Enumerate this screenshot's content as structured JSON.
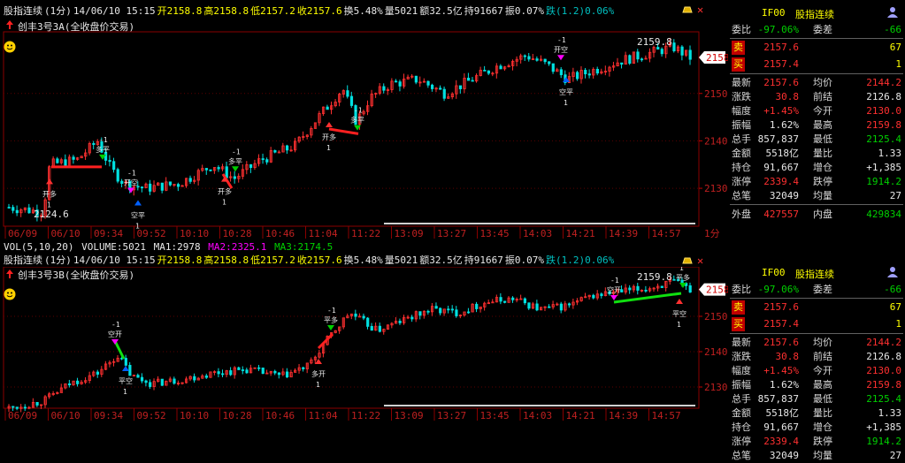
{
  "top_pane": {
    "header": [
      {
        "text": "股指连续",
        "color": "white"
      },
      {
        "text": "(1分)",
        "color": "white"
      },
      {
        "text": "14/06/10 15:15",
        "color": "white"
      },
      {
        "text": "开2158.8",
        "color": "yellow"
      },
      {
        "text": "高2158.8",
        "color": "yellow"
      },
      {
        "text": "低2157.2",
        "color": "yellow"
      },
      {
        "text": "收2157.6",
        "color": "yellow"
      },
      {
        "text": "换5.48%",
        "color": "white"
      },
      {
        "text": "量5021",
        "color": "white"
      },
      {
        "text": "额32.5亿",
        "color": "white"
      },
      {
        "text": "持91667",
        "color": "white"
      },
      {
        "text": "振0.07%",
        "color": "white"
      },
      {
        "text": "跌(1.2)0.06%",
        "color": "cyan"
      }
    ],
    "strategy": "创丰3号3A(全收盘价交易)",
    "y_ticks": [
      "2150",
      "2140",
      "2130"
    ],
    "price_tag": "2158",
    "high_label": "2159.8",
    "low_label": "2124.6",
    "x_ticks": [
      "06/09",
      "06/10",
      "09:34",
      "09:52",
      "10:10",
      "10:28",
      "10:46",
      "11:04",
      "11:22",
      "13:09",
      "13:27",
      "13:45",
      "14:03",
      "14:21",
      "14:39",
      "14:57"
    ],
    "period": "1分",
    "signals": [
      {
        "label": "开多",
        "qty": "1",
        "arrow": "up",
        "color": "#ff3030"
      },
      {
        "label": "多平",
        "qty": "-1",
        "arrow": "down",
        "color": "#00d000"
      },
      {
        "label": "开空",
        "qty": "-1",
        "arrow": "down",
        "color": "#ff00ff"
      },
      {
        "label": "空平",
        "qty": "1",
        "arrow": "up",
        "color": "#0060ff"
      },
      {
        "label": "开多",
        "qty": "1",
        "arrow": "up",
        "color": "#ff3030"
      },
      {
        "label": "多平",
        "qty": "-1",
        "arrow": "down",
        "color": "#00d000"
      },
      {
        "label": "开多",
        "qty": "1",
        "arrow": "up",
        "color": "#ff3030"
      },
      {
        "label": "多平",
        "qty": "-1",
        "arrow": "down",
        "color": "#00d000"
      },
      {
        "label": "开空",
        "qty": "-1",
        "arrow": "down",
        "color": "#ff00ff"
      },
      {
        "label": "空平",
        "qty": "1",
        "arrow": "up",
        "color": "#0060ff"
      }
    ]
  },
  "volume_header": {
    "label": "VOL(5,10,20)",
    "volume": "VOLUME:5021",
    "ma1": "MA1:2978",
    "ma2": "MA2:2325.1",
    "ma3": "MA3:2174.5"
  },
  "bottom_pane": {
    "header": [
      {
        "text": "股指连续",
        "color": "white"
      },
      {
        "text": "(1分)",
        "color": "white"
      },
      {
        "text": "14/06/10 15:15",
        "color": "white"
      },
      {
        "text": "开2158.8",
        "color": "yellow"
      },
      {
        "text": "高2158.8",
        "color": "yellow"
      },
      {
        "text": "低2157.2",
        "color": "yellow"
      },
      {
        "text": "收2157.6",
        "color": "yellow"
      },
      {
        "text": "换5.48%",
        "color": "white"
      },
      {
        "text": "量5021",
        "color": "white"
      },
      {
        "text": "额32.5亿",
        "color": "white"
      },
      {
        "text": "持91667",
        "color": "white"
      },
      {
        "text": "振0.07%",
        "color": "white"
      },
      {
        "text": "跌(1.2)0.06%",
        "color": "cyan"
      }
    ],
    "strategy": "创丰3号3B(全收盘价交易)",
    "y_ticks": [
      "2150",
      "2140",
      "2130"
    ],
    "price_tag": "2158",
    "high_label": "2159.8",
    "x_ticks": [
      "06/09",
      "06/10",
      "09:34",
      "09:52",
      "10:10",
      "10:28",
      "10:46",
      "11:04",
      "11:22",
      "13:09",
      "13:27",
      "13:45",
      "14:03",
      "14:21",
      "14:39",
      "14:57"
    ],
    "signals": [
      {
        "label": "空开",
        "qty": "-1",
        "arrow": "down",
        "color": "#ff00ff"
      },
      {
        "label": "平空",
        "qty": "1",
        "arrow": "up",
        "color": "#0060ff"
      },
      {
        "label": "多开",
        "qty": "1",
        "arrow": "up",
        "color": "#ff3030"
      },
      {
        "label": "平多",
        "qty": "-1",
        "arrow": "down",
        "color": "#00d000"
      },
      {
        "label": "空开",
        "qty": "-1",
        "arrow": "down",
        "color": "#ff00ff"
      },
      {
        "label": "平多",
        "qty": "1",
        "arrow": "down",
        "color": "#00d000"
      },
      {
        "label": "平空",
        "qty": "1",
        "arrow": "up",
        "color": "#ff3030"
      }
    ]
  },
  "quote_panel": {
    "symbol": "IF00",
    "name": "股指连续",
    "rows_top": [
      {
        "l": "委比",
        "v1": "-97.06%",
        "v1c": "green",
        "l2": "委差",
        "v2": "-66",
        "v2c": "green"
      }
    ],
    "ask": {
      "l": "卖",
      "price": "2157.6",
      "qty": "67"
    },
    "bid": {
      "l": "买",
      "price": "2157.4",
      "qty": "1"
    },
    "rows": [
      {
        "l": "最新",
        "v1": "2157.6",
        "v1c": "red",
        "l2": "均价",
        "v2": "2144.2",
        "v2c": "red"
      },
      {
        "l": "涨跌",
        "v1": "30.8",
        "v1c": "red",
        "l2": "前结",
        "v2": "2126.8",
        "v2c": "white"
      },
      {
        "l": "幅度",
        "v1": "+1.45%",
        "v1c": "red",
        "l2": "今开",
        "v2": "2130.0",
        "v2c": "red"
      },
      {
        "l": "振幅",
        "v1": "1.62%",
        "v1c": "white",
        "l2": "最高",
        "v2": "2159.8",
        "v2c": "red"
      },
      {
        "l": "总手",
        "v1": "857,837",
        "v1c": "white",
        "l2": "最低",
        "v2": "2125.4",
        "v2c": "green"
      },
      {
        "l": "金额",
        "v1": "5518亿",
        "v1c": "white",
        "l2": "量比",
        "v2": "1.33",
        "v2c": "white"
      },
      {
        "l": "持仓",
        "v1": "91,667",
        "v1c": "white",
        "l2": "增仓",
        "v2": "+1,385",
        "v2c": "white"
      },
      {
        "l": "涨停",
        "v1": "2339.4",
        "v1c": "red",
        "l2": "跌停",
        "v2": "1914.2",
        "v2c": "green"
      },
      {
        "l": "总笔",
        "v1": "32049",
        "v1c": "white",
        "l2": "均量",
        "v2": "27",
        "v2c": "white"
      }
    ],
    "outer": {
      "l": "外盘",
      "v1": "427557",
      "l2": "内盘",
      "v2": "429834"
    }
  },
  "colors": {
    "up": "#ff3030",
    "down": "#00e0e0",
    "frame": "#8a0000",
    "grid": "#5a0000"
  },
  "icons": [
    "smiley-icon",
    "red-up-arrow-icon",
    "gold-bar-icon",
    "close-icon",
    "person-icon"
  ]
}
